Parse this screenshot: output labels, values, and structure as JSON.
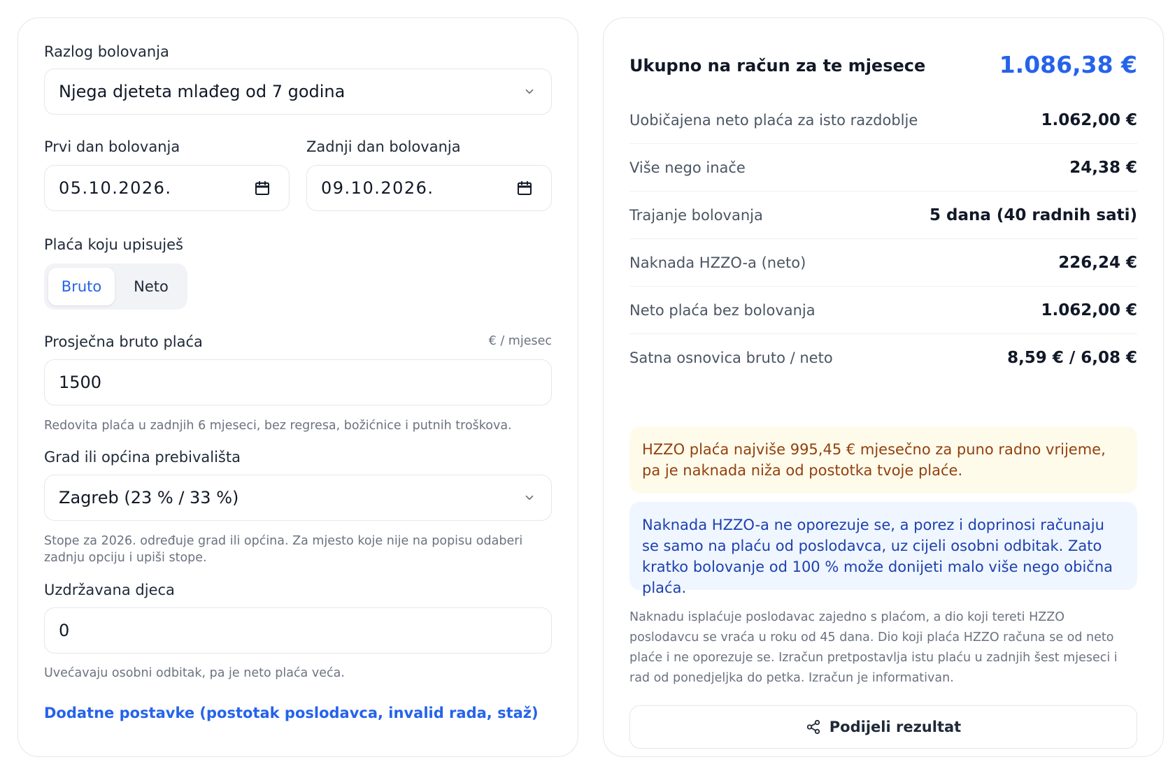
{
  "form": {
    "reason": {
      "label": "Razlog bolovanja",
      "value": "Njega djeteta mlađeg od 7 godina"
    },
    "first_day": {
      "label": "Prvi dan bolovanja",
      "value": "05.10.2026."
    },
    "last_day": {
      "label": "Zadnji dan bolovanja",
      "value": "09.10.2026."
    },
    "salary_type": {
      "label": "Plaća koju upisuješ",
      "options": [
        "Bruto",
        "Neto"
      ],
      "selected": "Bruto"
    },
    "avg_salary": {
      "label": "Prosječna bruto plaća",
      "unit": "€ / mjesec",
      "value": "1500",
      "help": "Redovita plaća u zadnjih 6 mjeseci, bez regresa, božićnice i putnih troškova."
    },
    "city": {
      "label": "Grad ili općina prebivališta",
      "value": "Zagreb (23 % / 33 %)",
      "help": "Stope za 2026. određuje grad ili općina. Za mjesto koje nije na popisu odaberi zadnju opciju i upiši stope."
    },
    "children": {
      "label": "Uzdržavana djeca",
      "value": "0",
      "help": "Uvećavaju osobni odbitak, pa je neto plaća veća."
    },
    "advanced_link": "Dodatne postavke (postotak poslodavca, invalid rada, staž)"
  },
  "results": {
    "total_label": "Ukupno na račun za te mjesece",
    "total_value": "1.086,38 €",
    "rows": [
      {
        "label": "Uobičajena neto plaća za isto razdoblje",
        "value": "1.062,00 €"
      },
      {
        "label": "Više nego inače",
        "value": "24,38 €"
      },
      {
        "label": "Trajanje bolovanja",
        "value": "5 dana (40 radnih sati)"
      },
      {
        "label": "Naknada HZZO-a (neto)",
        "value": "226,24 €"
      },
      {
        "label": "Neto plaća bez bolovanja",
        "value": "1.062,00 €"
      },
      {
        "label": "Satna osnovica bruto / neto",
        "value": "8,59 € / 6,08 €"
      }
    ],
    "warning": "HZZO plaća najviše 995,45 € mjesečno za puno radno vrijeme, pa je naknada niža od postotka tvoje plaće.",
    "info": "Naknada HZZO-a ne oporezuje se, a porez i doprinosi računaju se samo na plaću od poslodavca, uz cijeli osobni odbitak. Zato kratko bolovanje od 100 % može donijeti malo više nego obična plaća.",
    "footnote": "Naknadu isplaćuje poslodavac zajedno s plaćom, a dio koji tereti HZZO poslodavcu se vraća u roku od 45 dana. Dio koji plaća HZZO računa se od neto plaće i ne oporezuje se. Izračun pretpostavlja istu plaću u zadnjih šest mjeseci i rad od ponedjeljka do petka. Izračun je informativan.",
    "share_label": "Podijeli rezultat"
  },
  "colors": {
    "accent": "#2563eb",
    "warning_bg": "#fffbeb",
    "warning_text": "#92400e",
    "info_bg": "#eff6ff",
    "info_text": "#1e40af"
  },
  "icons": {
    "select_arrow": "chevron-down-icon",
    "date_picker": "calendar-icon",
    "share": "share-icon"
  }
}
